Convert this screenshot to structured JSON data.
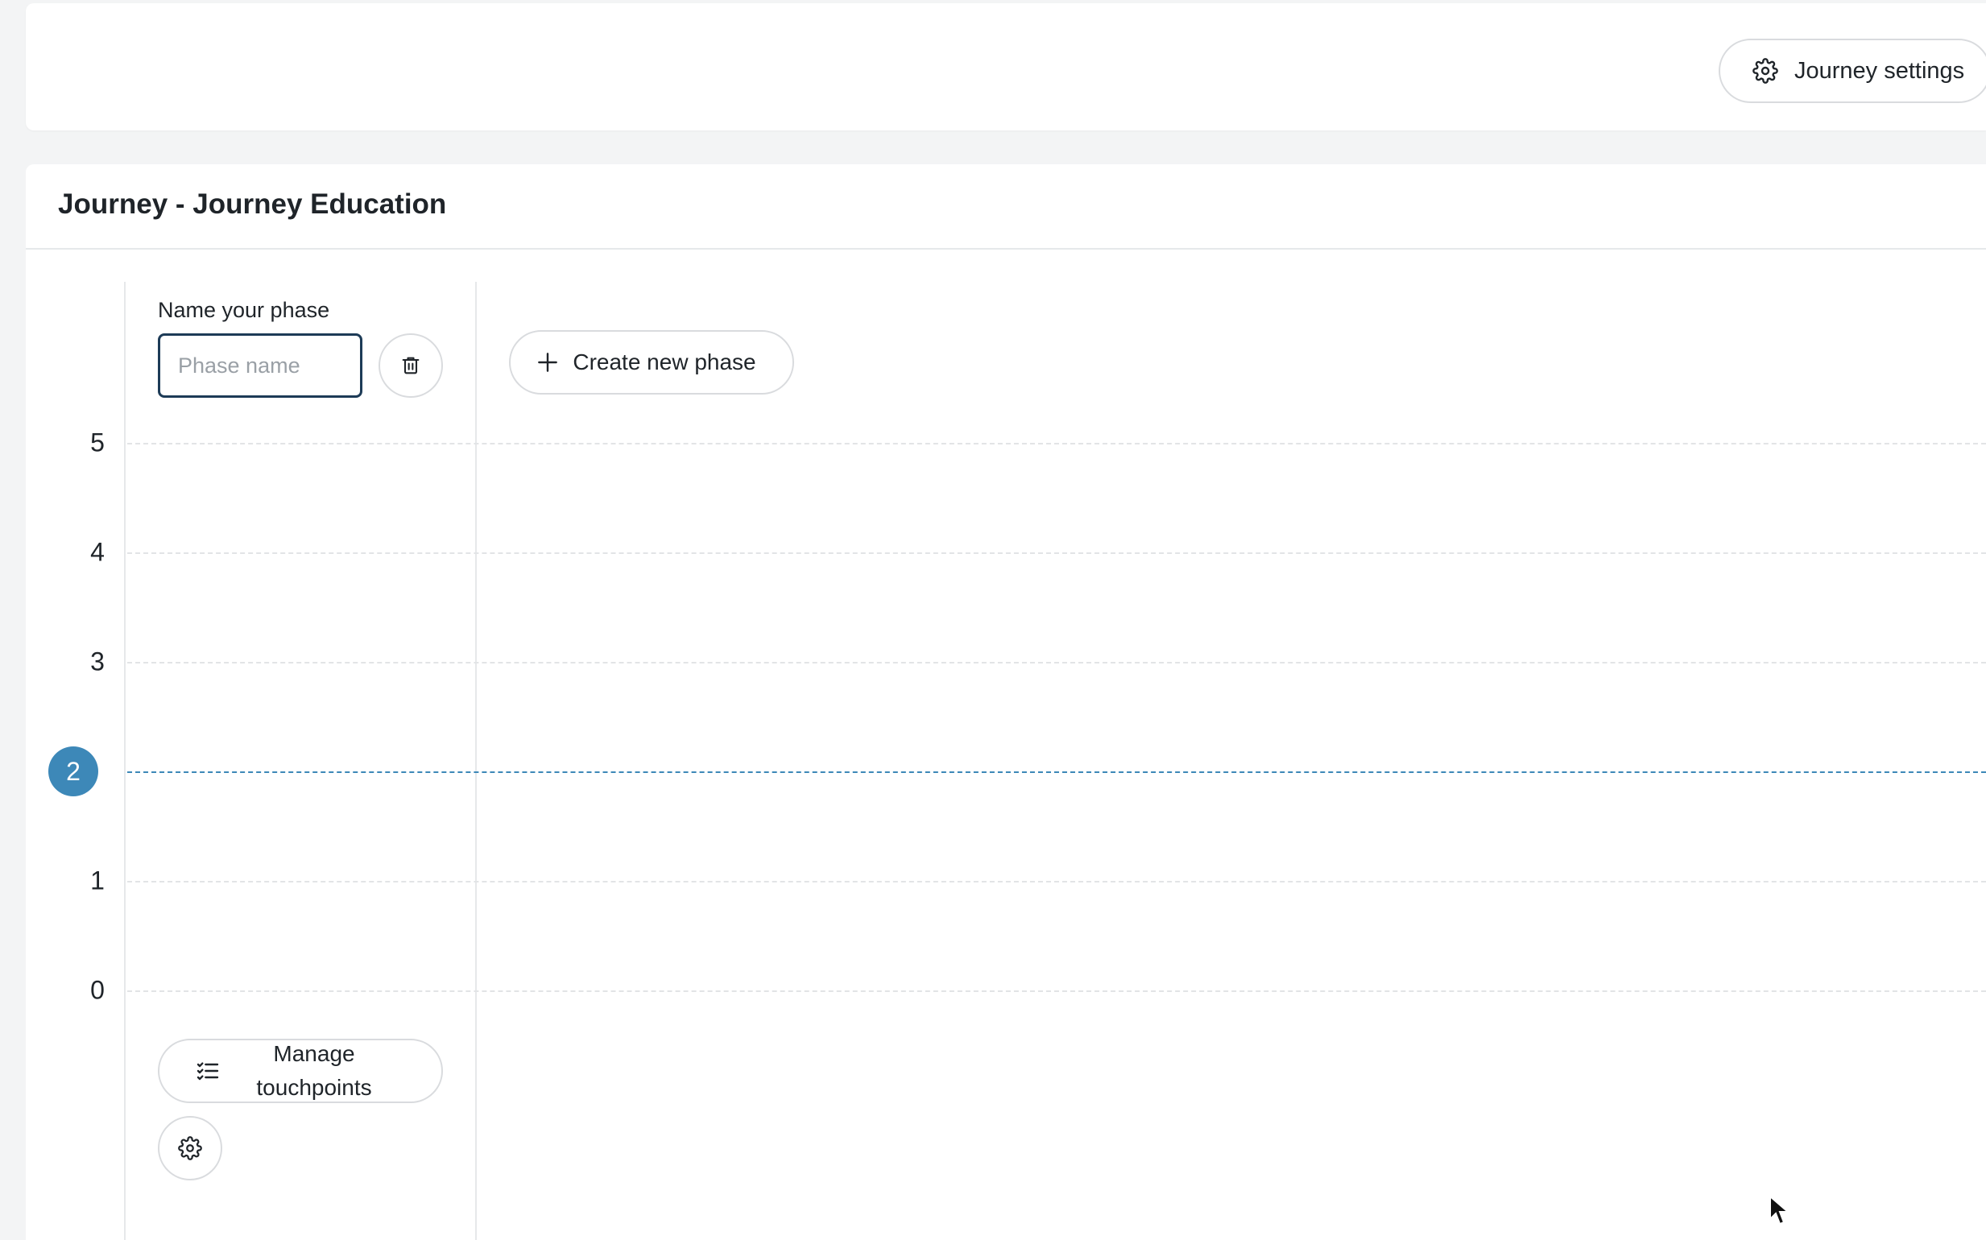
{
  "header": {
    "settings_label": "Journey settings",
    "settings_icon": "gear-icon"
  },
  "card": {
    "title": "Journey - Journey Education"
  },
  "phase": {
    "label": "Name your phase",
    "input_value": "",
    "input_placeholder": "Phase name",
    "delete_icon": "trash-icon"
  },
  "actions": {
    "create_phase_label": "Create new phase",
    "create_phase_icon": "plus-icon",
    "manage_touchpoints_label": "Manage touchpoints",
    "manage_touchpoints_icon": "checklist-icon",
    "settings_icon": "gear-icon"
  },
  "scale": {
    "levels": [
      "5",
      "4",
      "3",
      "2",
      "1",
      "0"
    ],
    "selected": "2",
    "selected_color": "#3d88b8"
  },
  "colors": {
    "accent": "#3d88b8",
    "input_border": "#1d3b57"
  }
}
